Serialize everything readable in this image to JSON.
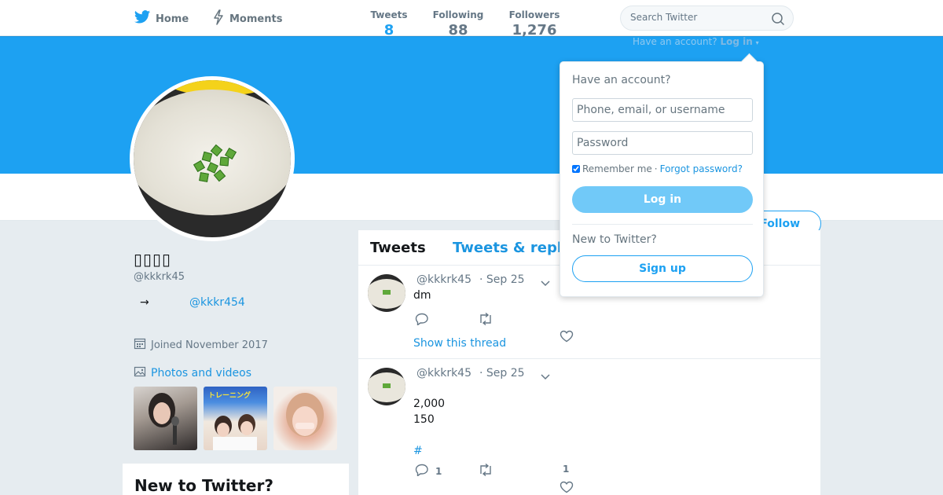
{
  "nav": {
    "home_label": "Home",
    "moments_label": "Moments",
    "search_placeholder": "Search Twitter"
  },
  "login_hint": {
    "question": "Have an account?",
    "login_label": "Log in",
    "caret": "▾"
  },
  "profile": {
    "name": "▯▯▯▯",
    "handle": "@kkkrk45",
    "bio_arrow": "→",
    "bio_link": "@kkkr454",
    "joined": "Joined November 2017",
    "photos_label": "Photos and videos",
    "stats": [
      {
        "label": "Tweets",
        "value": "8"
      },
      {
        "label": "Following",
        "value": "88"
      },
      {
        "label": "Followers",
        "value": "1,276"
      }
    ],
    "follow_label": "Follow"
  },
  "timeline": {
    "tabs": [
      "Tweets",
      "Tweets & repl"
    ],
    "tweets": [
      {
        "handle": "@kkkrk45",
        "date": "· Sep 25",
        "lines": [
          "dm"
        ],
        "replies": "",
        "retweets": "",
        "likes": "",
        "thread_link": "Show this thread"
      },
      {
        "handle": "@kkkrk45",
        "date": "· Sep 25",
        "lines": [
          "2,000",
          "150"
        ],
        "hashtag": "#",
        "replies": "1",
        "retweets": "",
        "likes": "1"
      }
    ]
  },
  "sidebar_card": {
    "title": "New to Twitter?"
  },
  "thumb2_caption": "トレーニング",
  "dropdown": {
    "title": "Have an account?",
    "username_placeholder": "Phone, email, or username",
    "password_placeholder": "Password",
    "remember_label": "Remember me",
    "separator": " · ",
    "forgot_label": "Forgot password?",
    "login_button": "Log in",
    "new_label": "New to Twitter?",
    "signup_button": "Sign up"
  },
  "colors": {
    "brand_blue": "#1da1f2",
    "link_blue": "#1b95e0",
    "muted_text": "#657786",
    "background": "#e6ecf0"
  }
}
